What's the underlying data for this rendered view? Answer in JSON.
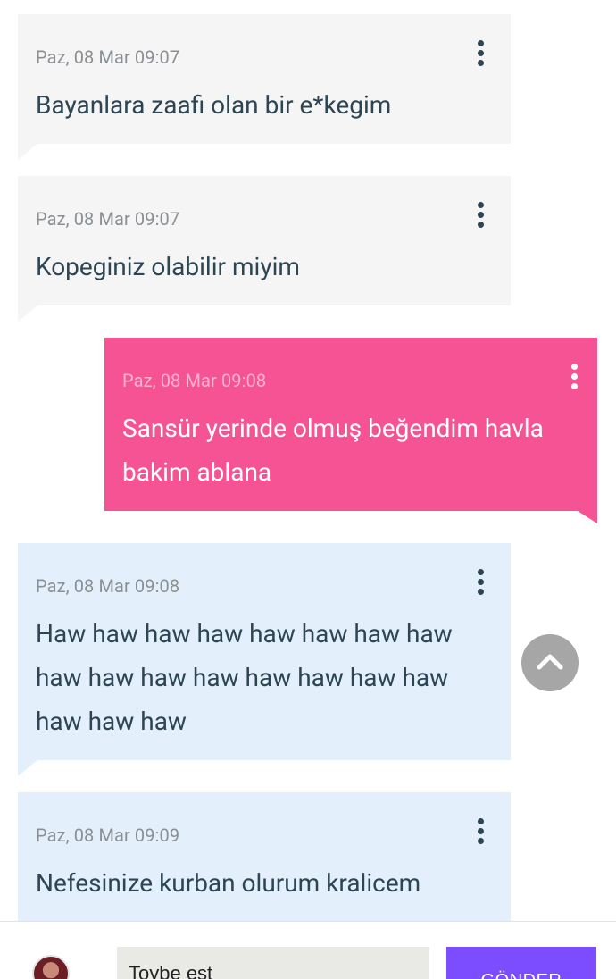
{
  "messages": [
    {
      "time": "Paz, 08 Mar 09:07",
      "text": "Bayanlara zaafi olan bir e*kegim"
    },
    {
      "time": "Paz, 08 Mar 09:07",
      "text": "Kopeginiz olabilir miyim"
    },
    {
      "time": "Paz, 08 Mar 09:08",
      "text": "Sansür yerinde olmuş beğendim havla bakim ablana"
    },
    {
      "time": "Paz, 08 Mar 09:08",
      "text": "Haw haw haw haw haw haw haw haw haw haw haw haw haw haw haw haw haw haw haw"
    },
    {
      "time": "Paz, 08 Mar 09:09",
      "text": "Nefesinize kurban olurum kralicem"
    }
  ],
  "composer": {
    "input_value": "Toybe est",
    "send_label": "GÖNDER"
  },
  "icons": {
    "message_menu": "more-vertical-icon",
    "scroll_top": "chevron-up-icon",
    "avatar": "user-avatar"
  },
  "colors": {
    "incoming_gray": "#f5f5f5",
    "incoming_blue": "#e3f0fc",
    "outgoing_pink": "#f55394",
    "text_dark": "#2e4553",
    "send_button": "#7b4dff",
    "scroll_button": "#a6a6a6"
  }
}
